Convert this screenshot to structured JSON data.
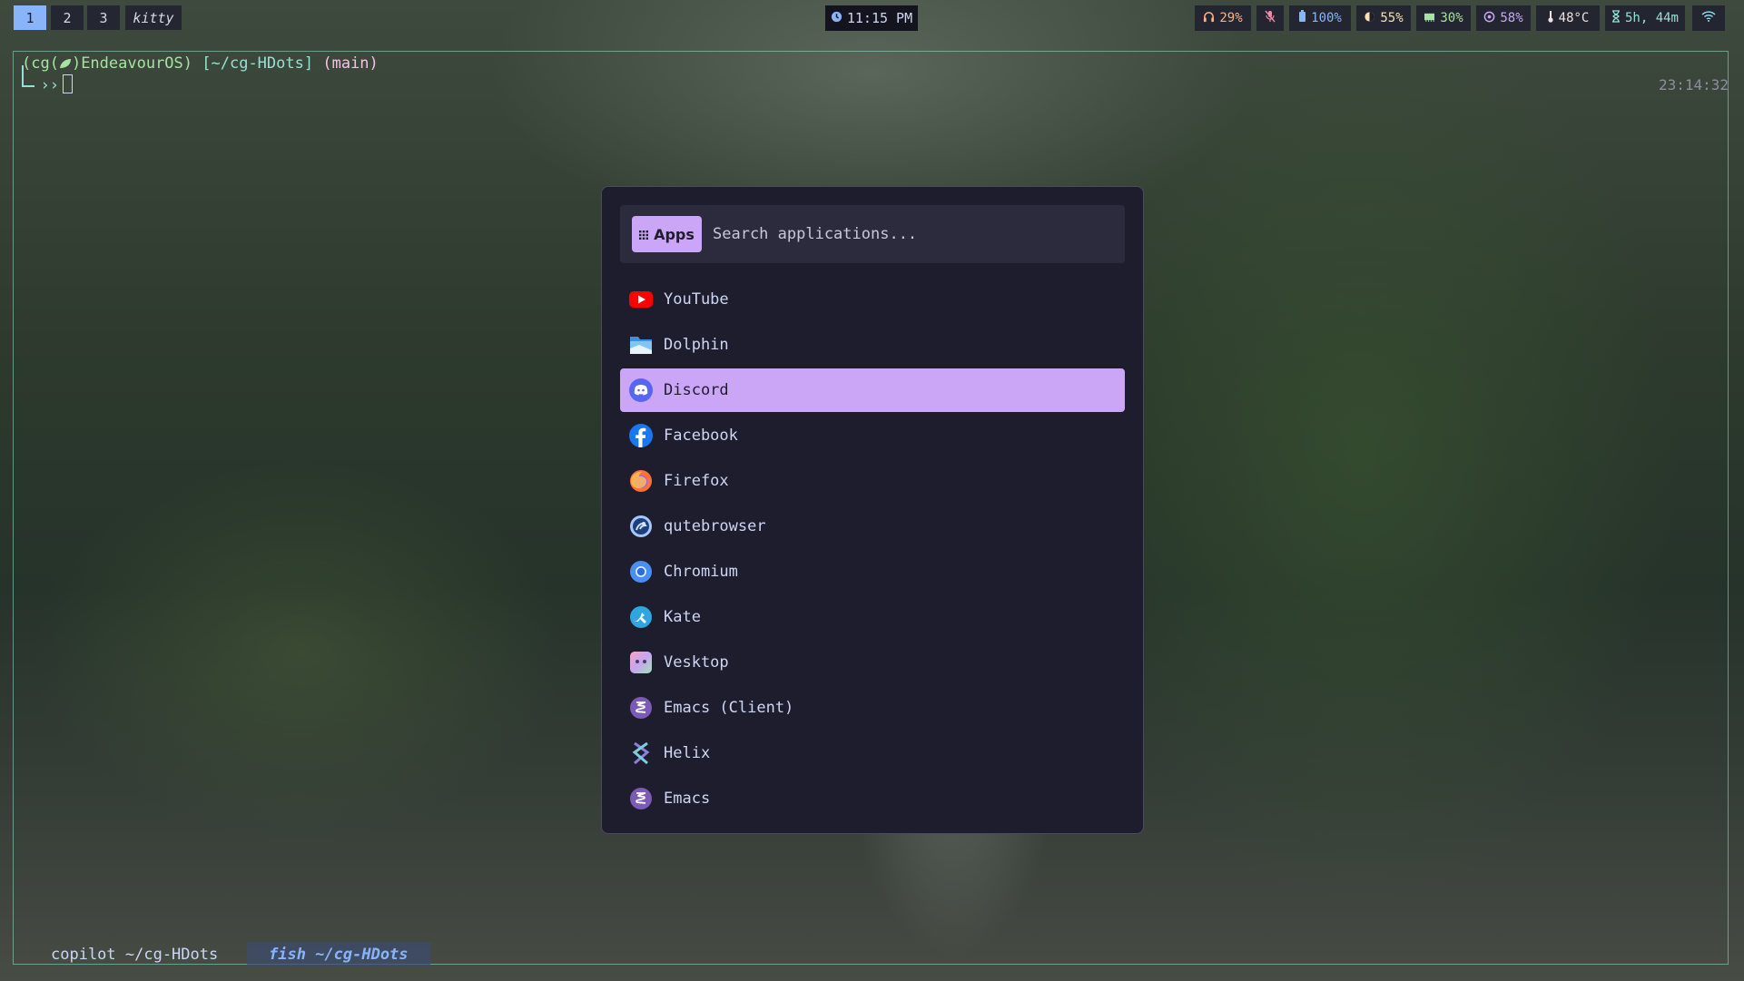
{
  "topbar": {
    "workspaces": [
      "1",
      "2",
      "3"
    ],
    "active_window": "kitty",
    "clock": "11:15 PM",
    "status": {
      "headphones": "29%",
      "brightness": "100%",
      "volume": "55%",
      "memory": "30%",
      "cpu": "58%",
      "temperature": "48°C",
      "uptime": "5h, 44m"
    }
  },
  "terminal": {
    "prompt_user": "(cg(",
    "prompt_host": ")EndeavourOS)",
    "prompt_path": "[~/cg-HDots]",
    "prompt_branch": "(main)",
    "prompt_symbol": "››",
    "right_time": "23:14:32",
    "tabs": [
      "copilot ~/cg-HDots",
      "fish ~/cg-HDots"
    ]
  },
  "launcher": {
    "mode_label": "Apps",
    "search_placeholder": "Search applications...",
    "selected_index": 2,
    "apps": [
      {
        "name": "YouTube",
        "icon": "youtube-icon"
      },
      {
        "name": "Dolphin",
        "icon": "dolphin-icon"
      },
      {
        "name": "Discord",
        "icon": "discord-icon"
      },
      {
        "name": "Facebook",
        "icon": "facebook-icon"
      },
      {
        "name": "Firefox",
        "icon": "firefox-icon"
      },
      {
        "name": "qutebrowser",
        "icon": "qutebrowser-icon"
      },
      {
        "name": "Chromium",
        "icon": "chromium-icon"
      },
      {
        "name": "Kate",
        "icon": "kate-icon"
      },
      {
        "name": "Vesktop",
        "icon": "vesktop-icon"
      },
      {
        "name": "Emacs (Client)",
        "icon": "emacs-icon"
      },
      {
        "name": "Helix",
        "icon": "helix-icon"
      },
      {
        "name": "Emacs",
        "icon": "emacs-icon"
      }
    ]
  },
  "colors": {
    "accent": "#cba6f7",
    "workspace_active": "#89b4fa",
    "launcher_bg": "#1e1d2e",
    "terminal_border": "#94e2d5"
  }
}
